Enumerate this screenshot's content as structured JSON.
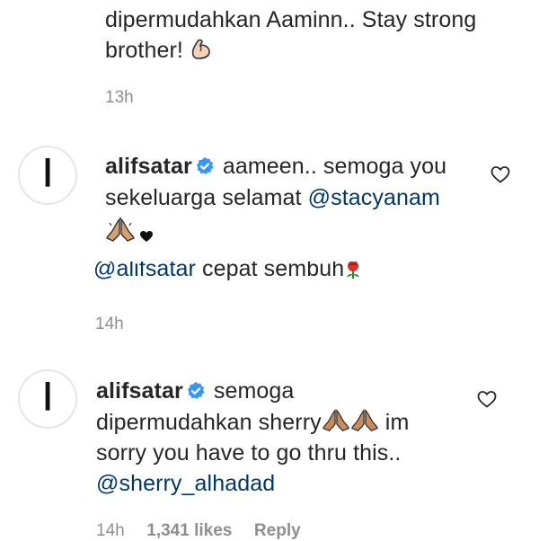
{
  "comment_top": {
    "text_line1": "dipermudahkan Aaminn.. Stay strong",
    "text_line2": "brother!",
    "emoji": "flexed-biceps-icon",
    "time": "13h"
  },
  "reply1": {
    "username": "alifsatar",
    "text_a": "aameen.. semoga you",
    "text_b": "sekeluarga selamat",
    "mention": "@stacyanam",
    "emoji": "folded-hands-icon",
    "avatar_glyph": "ا"
  },
  "partial_comment": {
    "mention": "@alifsatar",
    "text": "cepat sembuh",
    "emoji": "rose-icon",
    "time": "14h"
  },
  "reply2": {
    "username": "alifsatar",
    "text_a": "semoga",
    "text_b": "dipermudahkan sherry",
    "text_c": "im",
    "text_d": "sorry you have to go thru this..",
    "mention": "@sherry_alhadad",
    "time": "14h",
    "likes": "1,341 likes",
    "reply_label": "Reply",
    "avatar_glyph": "ا"
  },
  "colors": {
    "mention": "#00376b",
    "meta": "#8e8e8e",
    "verified": "#3897f0"
  }
}
